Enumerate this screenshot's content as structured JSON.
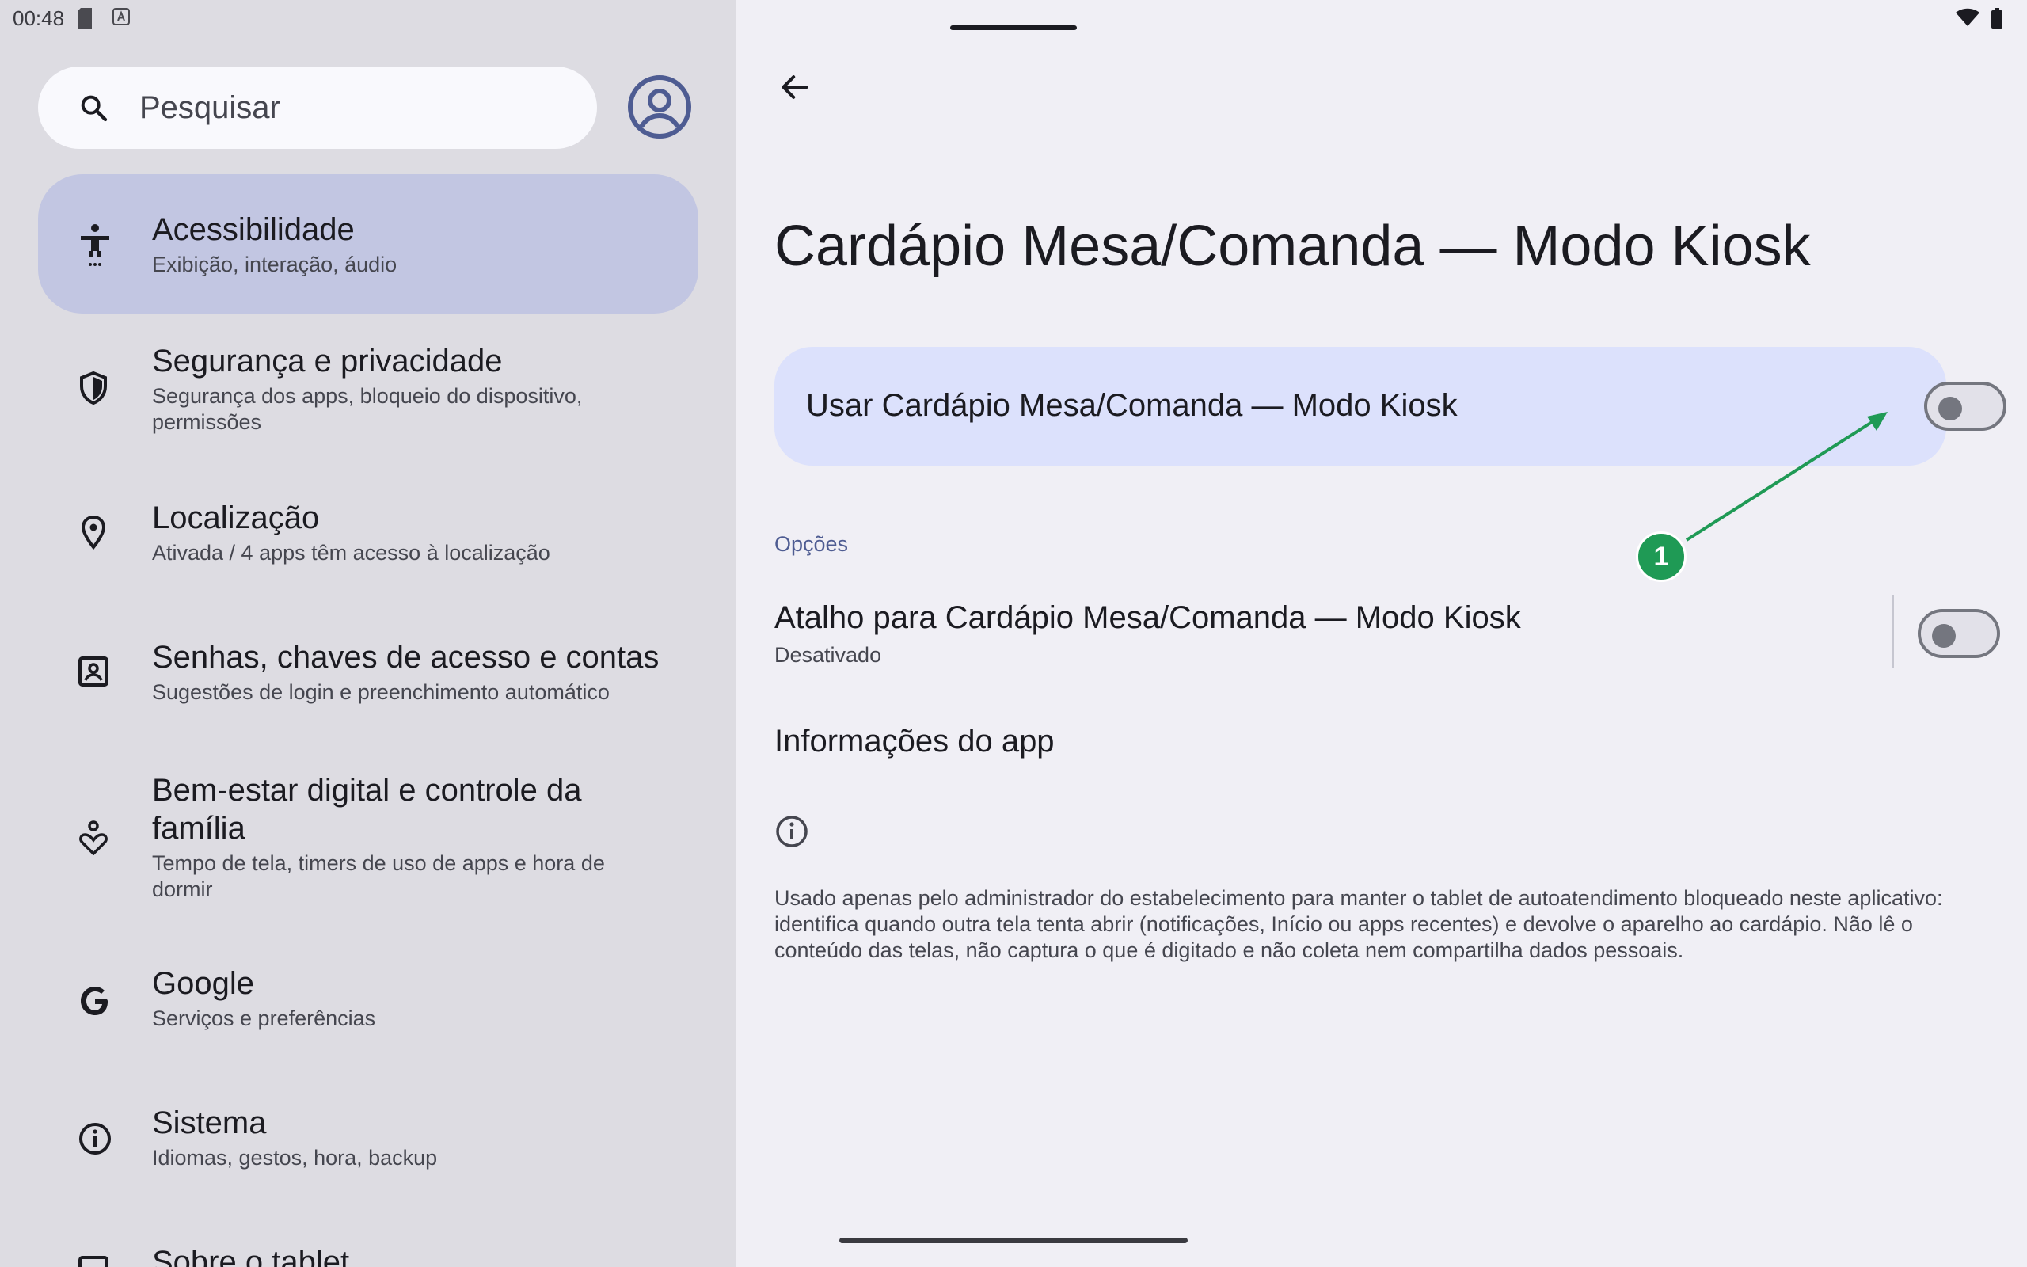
{
  "status_bar": {
    "time": "00:48",
    "left_icons": [
      "sd-card-icon",
      "keyboard-icon"
    ],
    "right_icons": [
      "wifi-icon",
      "battery-icon"
    ]
  },
  "search": {
    "placeholder": "Pesquisar"
  },
  "sidebar": {
    "items": [
      {
        "title": "Acessibilidade",
        "subtitle": "Exibição, interação, áudio",
        "icon": "accessibility-icon",
        "selected": true
      },
      {
        "title": "Segurança e privacidade",
        "subtitle": "Segurança dos apps, bloqueio do dispositivo, permissões",
        "icon": "shield-icon"
      },
      {
        "title": "Localização",
        "subtitle": "Ativada / 4 apps têm acesso à localização",
        "icon": "location-pin-icon"
      },
      {
        "title": "Senhas, chaves de acesso e contas",
        "subtitle": "Sugestões de login e preenchimento automático",
        "icon": "account-box-icon"
      },
      {
        "title": "Bem-estar digital e controle da família",
        "subtitle": "Tempo de tela, timers de uso de apps e hora de dormir",
        "icon": "wellbeing-icon"
      },
      {
        "title": "Google",
        "subtitle": "Serviços e preferências",
        "icon": "google-icon"
      },
      {
        "title": "Sistema",
        "subtitle": "Idiomas, gestos, hora, backup",
        "icon": "info-icon"
      },
      {
        "title": "Sobre o tablet",
        "subtitle": "",
        "icon": "tablet-icon"
      }
    ]
  },
  "detail": {
    "title": "Cardápio Mesa/Comanda — Modo Kiosk",
    "main_toggle": {
      "label": "Usar Cardápio Mesa/Comanda — Modo Kiosk",
      "checked": false
    },
    "options_header": "Opções",
    "shortcut": {
      "title": "Atalho para Cardápio Mesa/Comanda — Modo Kiosk",
      "subtitle": "Desativado",
      "checked": false
    },
    "app_info_label": "Informações do app",
    "description": "Usado apenas pelo administrador do estabelecimento para manter o tablet de autoatendimento bloqueado neste aplicativo: identifica quando outra tela tenta abrir (notificações, Início ou apps recentes) e devolve o aparelho ao cardápio. Não lê o conteúdo das telas, não captura o que é digitado e não coleta nem compartilha dados pessoais."
  },
  "annotation": {
    "badge_number": "1",
    "color": "#1f9a55"
  },
  "colors": {
    "selected_item": "#c2c6e2",
    "card": "#dce1fc",
    "accent": "#4e5c92",
    "left_pane": "#dddce2",
    "right_pane": "#f0eff5"
  }
}
